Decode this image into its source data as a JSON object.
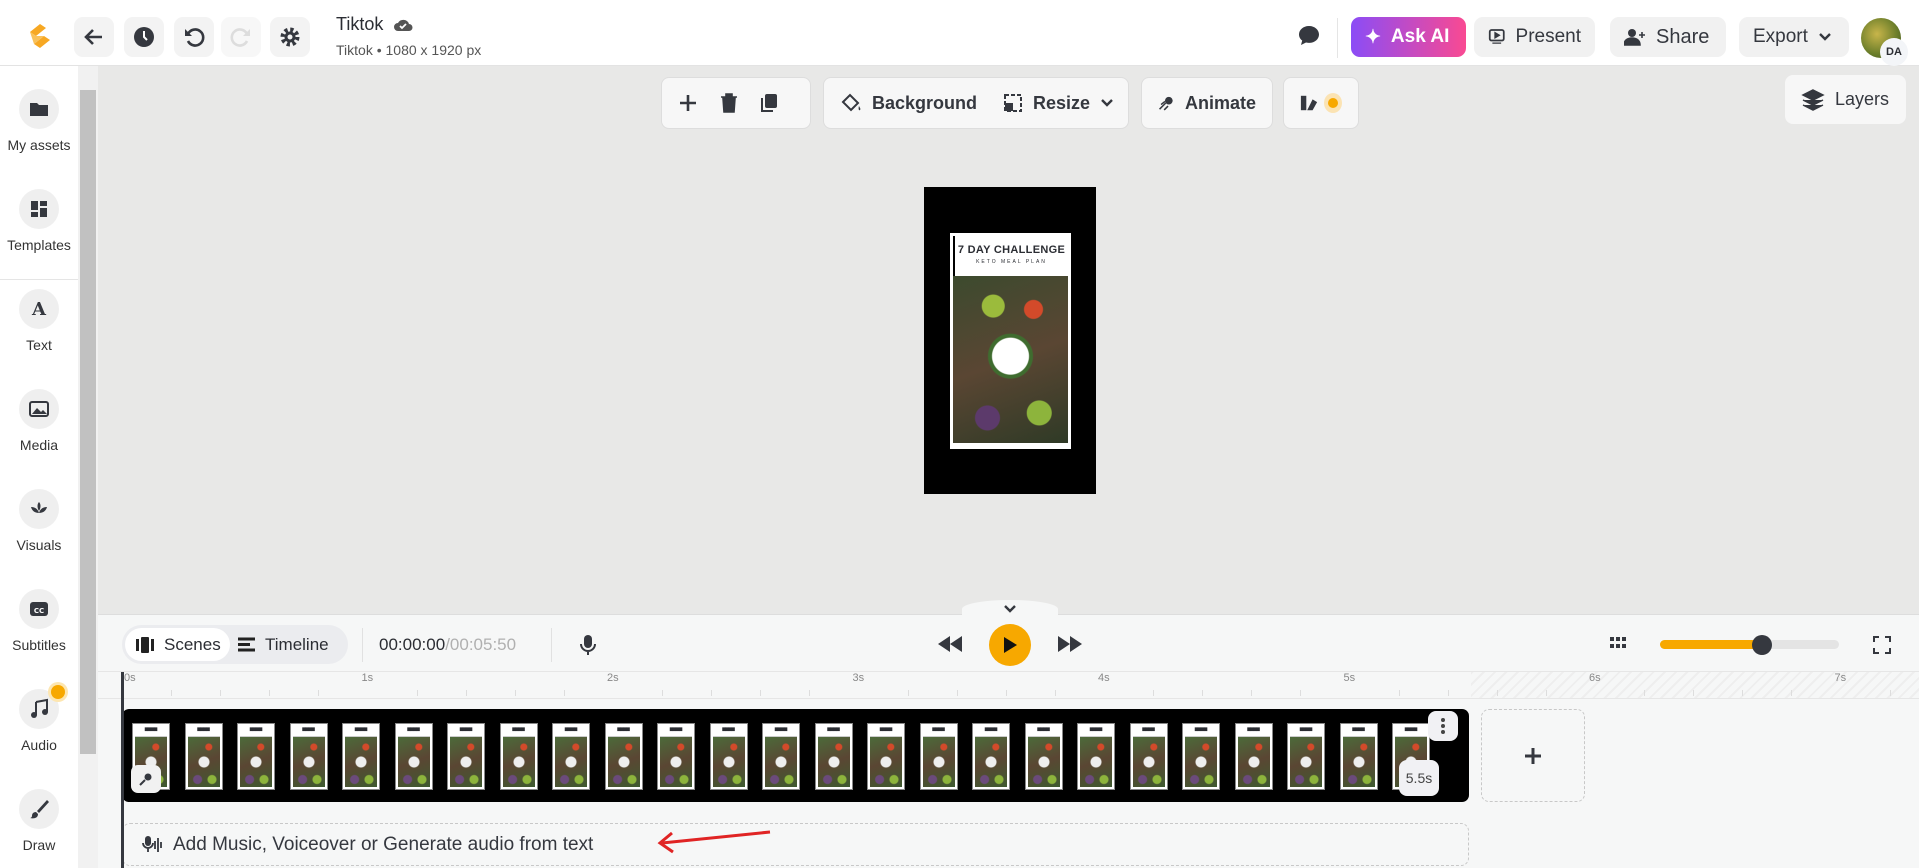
{
  "header": {
    "title": "Tiktok",
    "subtitle": "Tiktok • 1080 x 1920 px",
    "ask_ai": "Ask AI",
    "present": "Present",
    "share": "Share",
    "export": "Export",
    "avatar_initials": "DA",
    "brand_color": "#f7a823",
    "ask_ai_gradient": [
      "#8b4cf6",
      "#f94a92"
    ]
  },
  "sidebar": {
    "items": [
      {
        "label": "My assets",
        "icon": "folder-icon"
      },
      {
        "label": "Templates",
        "icon": "templates-icon"
      },
      {
        "label": "Text",
        "icon": "text-icon"
      },
      {
        "label": "Media",
        "icon": "image-icon"
      },
      {
        "label": "Visuals",
        "icon": "visuals-icon"
      },
      {
        "label": "Subtitles",
        "icon": "cc-icon"
      },
      {
        "label": "Audio",
        "icon": "music-icon"
      },
      {
        "label": "Draw",
        "icon": "brush-icon"
      }
    ]
  },
  "toolbar": {
    "background": "Background",
    "resize": "Resize",
    "animate": "Animate",
    "layers": "Layers"
  },
  "artboard": {
    "title": "7 DAY CHALLENGE",
    "subtitle": "KETO MEAL PLAN"
  },
  "timeline": {
    "scenes": "Scenes",
    "timeline": "Timeline",
    "current_time": "00:00:00",
    "total_time": "/00:05:50",
    "zoom_level": 0.57,
    "ticks": [
      "0s",
      "1s",
      "2s",
      "3s",
      "4s",
      "5s",
      "6s",
      "7s"
    ],
    "clip_duration": "5.5s",
    "audio_prompt": "Add Music, Voiceover or Generate audio from text",
    "accent": "#f7a800",
    "annotation_color": "#e02424"
  }
}
